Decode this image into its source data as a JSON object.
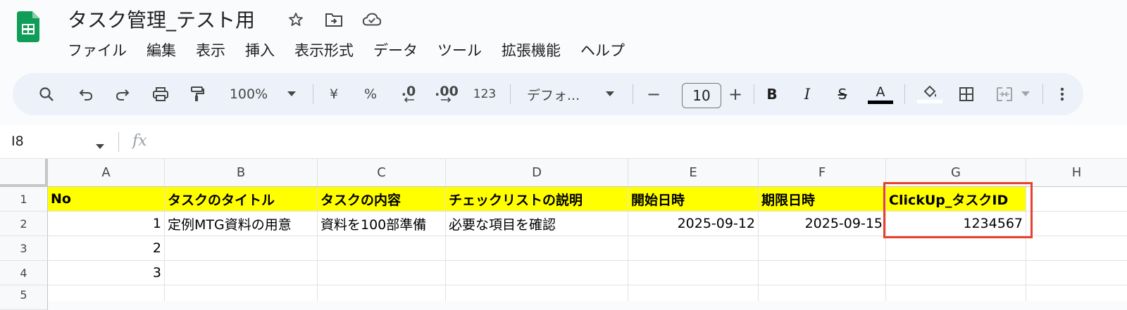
{
  "app": {
    "title": "タスク管理_テスト用"
  },
  "menu": [
    "ファイル",
    "編集",
    "表示",
    "挿入",
    "表示形式",
    "データ",
    "ツール",
    "拡張機能",
    "ヘルプ"
  ],
  "toolbar": {
    "zoom": "100%",
    "currency": "¥",
    "percent": "%",
    "decrease_decimal": ".0",
    "increase_decimal": ".00",
    "number_format": "123",
    "font": "デフォ...",
    "font_size": "10",
    "minus": "−",
    "plus": "+",
    "bold": "B",
    "italic": "I",
    "strike": "S",
    "text_color": "A"
  },
  "formula_bar": {
    "cell_ref": "I8",
    "fx": "fx"
  },
  "sheet": {
    "columns": [
      "A",
      "B",
      "C",
      "D",
      "E",
      "F",
      "G",
      "H"
    ],
    "rows": [
      "1",
      "2",
      "3",
      "4",
      "5"
    ],
    "header_row": [
      "No",
      "タスクのタイトル",
      "タスクの内容",
      "チェックリストの説明",
      "開始日時",
      "期限日時",
      "ClickUp_タスクID"
    ],
    "row2": [
      "1",
      "定例MTG資料の用意",
      "資料を100部準備",
      "必要な項目を確認",
      "2025-09-12",
      "2025-09-15",
      "1234567"
    ],
    "row3": [
      "2"
    ],
    "row4": [
      "3"
    ]
  },
  "colors": {
    "header_fill": "#ffff00",
    "highlight_border": "#e8412d",
    "logo_green": "#0f9d58"
  }
}
